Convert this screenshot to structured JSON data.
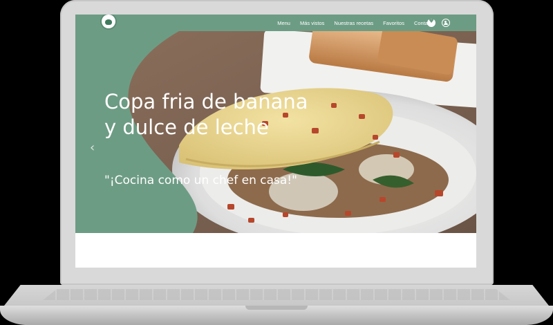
{
  "nav": {
    "items": [
      {
        "label": "Menu"
      },
      {
        "label": "Más vistos"
      },
      {
        "label": "Nuestras recetas"
      },
      {
        "label": "Favoritos"
      },
      {
        "label": "Contacto"
      }
    ],
    "icons": [
      "logo-icon",
      "heart-icon",
      "user-icon"
    ],
    "color": "#6d9c84"
  },
  "hero": {
    "title": "Copa fria de banana y dulce de leche",
    "subtitle": "\"¡Cocina como un chef en casa!\"",
    "prev_icon": "chevron-left-icon",
    "overlay_color": "#6d9c84"
  }
}
